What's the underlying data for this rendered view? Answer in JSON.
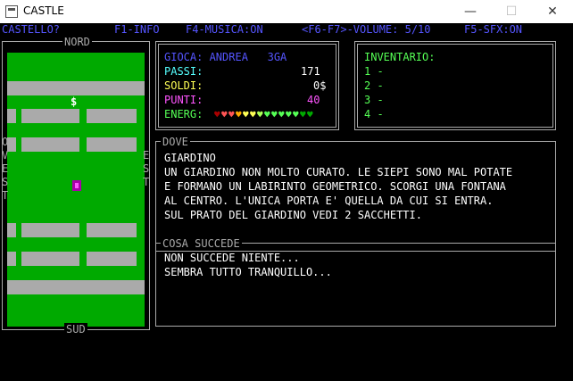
{
  "window": {
    "title": "CASTLE",
    "min_glyph": "—",
    "max_glyph": "☐",
    "close_glyph": "✕"
  },
  "statusbar": {
    "left": "CASTELLO?",
    "info": "F1-INFO",
    "music": "F4-MUSICA:ON",
    "volume": "<F6-F7>-VOLUME: 5/10",
    "sfx": "F5-SFX:ON"
  },
  "map": {
    "north": "NORD",
    "south": "SUD",
    "west": [
      "O",
      "V",
      "E",
      "S",
      "T"
    ],
    "east": [
      "E",
      "S",
      "T"
    ],
    "coin_glyph": "$"
  },
  "stats": {
    "header": "GIOCA: ANDREA   3GA",
    "steps_label": "PASSI:",
    "steps_value": "171",
    "money_label": "SOLDI:",
    "money_value": "0$",
    "points_label": "PUNTI:",
    "points_value": "40",
    "energy_label": "ENERG:",
    "energy_hearts": [
      "#aa0000",
      "#ff5555",
      "#ff5555",
      "#ffaa00",
      "#ffff55",
      "#ffff55",
      "#aaff55",
      "#55ff55",
      "#55ff55",
      "#55ff55",
      "#55ff55",
      "#55ff55",
      "#00aa00",
      "#00aa00"
    ],
    "colors": {
      "label_cyan": "#55ffff",
      "money": "#ffff55",
      "points": "#ff55ff",
      "energy": "#55ff55",
      "value": "#ffffff"
    }
  },
  "inventory": {
    "title": "INVENTARIO:",
    "slots": [
      "1 -",
      "2 -",
      "3 -",
      "4 -"
    ],
    "color": "#55ff55"
  },
  "where": {
    "title": "DOVE",
    "lines": [
      "GIARDINO",
      "UN GIARDINO NON MOLTO CURATO. LE SIEPI SONO MAL POTATE",
      "E FORMANO UN LABIRINTO GEOMETRICO. SCORGI UNA FONTANA",
      "AL CENTRO. L'UNICA PORTA E' QUELLA DA CUI SI ENTRA.",
      "SUL PRATO DEL GIARDINO VEDI 2 SACCHETTI."
    ]
  },
  "events": {
    "title": "COSA SUCCEDE",
    "lines": [
      "NON SUCCEDE NIENTE...",
      "SEMBRA TUTTO TRANQUILLO..."
    ]
  }
}
